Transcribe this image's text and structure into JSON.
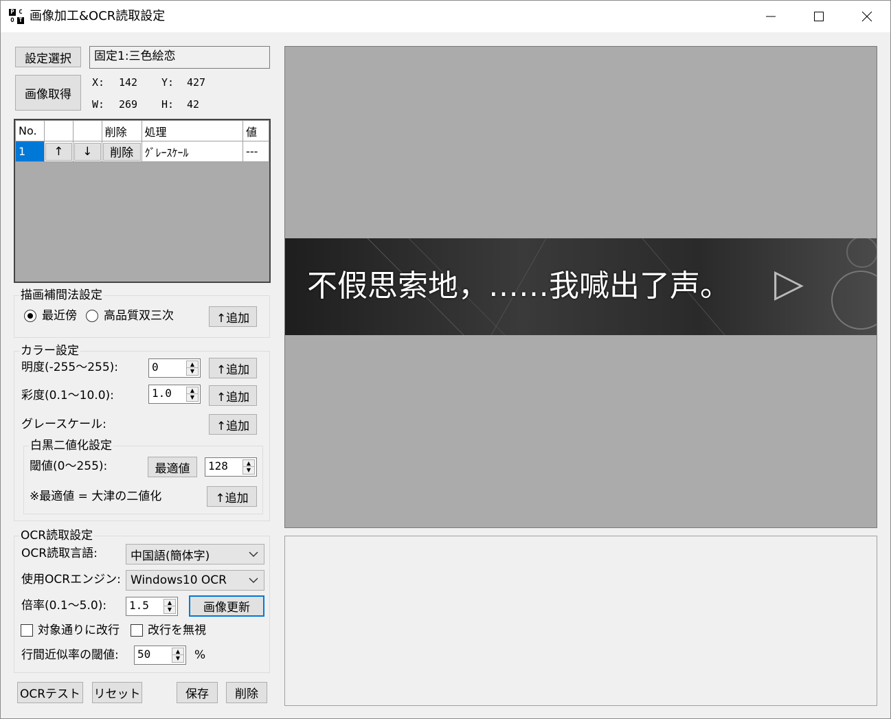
{
  "window": {
    "title": "画像加工&OCR読取設定",
    "icon_letters": [
      "P",
      "C",
      "O",
      "T"
    ]
  },
  "setting": {
    "select_button": "設定選択",
    "current": "固定1:三色絵恋"
  },
  "capture": {
    "button": "画像取得",
    "x_label": "X:",
    "x_value": "142",
    "y_label": "Y:",
    "y_value": "427",
    "w_label": "W:",
    "w_value": "269",
    "h_label": "H:",
    "h_value": "42"
  },
  "process_table": {
    "headers": [
      "No.",
      "",
      "",
      "削除",
      "処理",
      "値"
    ],
    "rows": [
      {
        "no": "1",
        "up": "↑",
        "down": "↓",
        "delete": "削除",
        "process": "ｸﾞﾚｰｽｹｰﾙ",
        "value": "---"
      }
    ]
  },
  "interpolation": {
    "group_label": "描画補間法設定",
    "option1": "最近傍",
    "option2": "高品質双三次",
    "selected": "最近傍",
    "add_button": "↑追加"
  },
  "color": {
    "group_label": "カラー設定",
    "brightness_label": "明度(-255～255):",
    "brightness_value": "0",
    "saturation_label": "彩度(0.1～10.0):",
    "saturation_value": "1.0",
    "grayscale_label": "グレースケール:",
    "add_button": "↑追加"
  },
  "binarize": {
    "group_label": "白黒二値化設定",
    "threshold_label": "閾値(0～255):",
    "optimal_button": "最適値",
    "threshold_value": "128",
    "note": "※最適値 = 大津の二値化",
    "add_button": "↑追加"
  },
  "ocr": {
    "group_label": "OCR読取設定",
    "language_label": "OCR読取言語:",
    "language_value": "中国語(簡体字)",
    "engine_label": "使用OCRエンジン:",
    "engine_value": "Windows10 OCR",
    "scale_label": "倍率(0.1～5.0):",
    "scale_value": "1.5",
    "refresh_button": "画像更新",
    "newline_label": "対象通りに改行",
    "ignore_newline_label": "改行を無視",
    "line_threshold_label": "行間近似率の閾値:",
    "line_threshold_value": "50",
    "percent": "%"
  },
  "bottom_buttons": {
    "ocr_test": "OCRテスト",
    "reset": "リセット",
    "save": "保存",
    "delete": "削除"
  },
  "preview": {
    "caption_text": "不假思索地，……我喊出了声。",
    "next_glyph": "▷"
  },
  "colors": {
    "preview_bg": "#ababab",
    "banner_bg": "#2b2b2b",
    "selected_row": "#0078d7",
    "focus_border": "#0078d7"
  }
}
